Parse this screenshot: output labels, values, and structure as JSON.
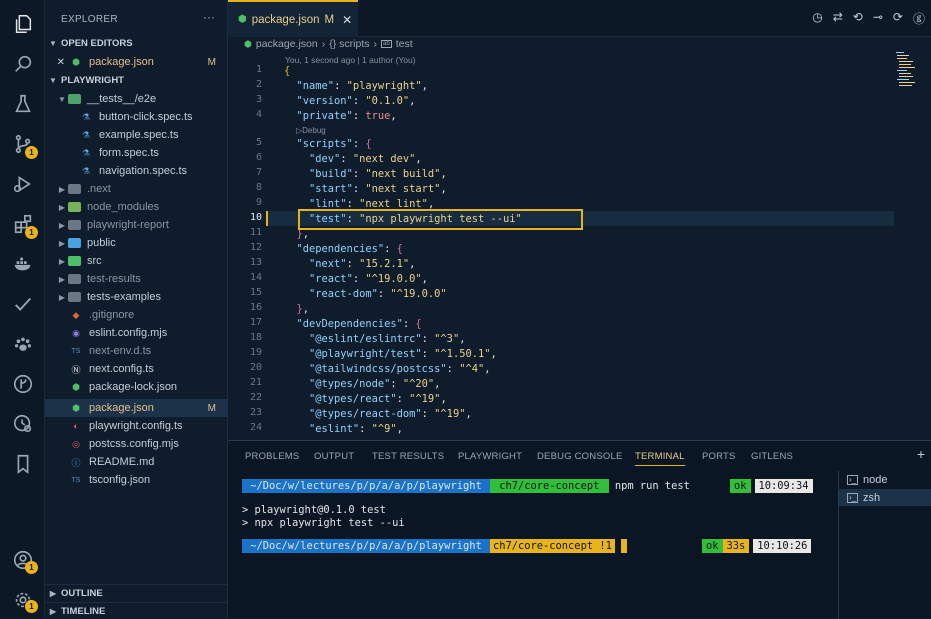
{
  "activity_bar": {
    "items": [
      {
        "icon": "files-icon"
      },
      {
        "icon": "search-icon"
      },
      {
        "icon": "beaker-icon"
      },
      {
        "icon": "source-control-icon",
        "badge": "1"
      },
      {
        "icon": "run-debug-icon"
      },
      {
        "icon": "extensions-icon",
        "badge": "1"
      },
      {
        "icon": "docker-icon"
      },
      {
        "icon": "checkmark-icon"
      },
      {
        "icon": "paw-icon"
      },
      {
        "icon": "git-graph-icon"
      },
      {
        "icon": "timeline-search-icon"
      },
      {
        "icon": "bookmark-icon"
      }
    ],
    "account_badge": "1",
    "settings_badge": "1"
  },
  "sidebar": {
    "title": "EXPLORER",
    "more": "···",
    "open_editors_label": "OPEN EDITORS",
    "open_editor": {
      "name": "package.json",
      "status": "M"
    },
    "workspace_label": "PLAYWRIGHT",
    "tree": [
      {
        "name": "__tests__/e2e",
        "kind": "folder-open"
      },
      {
        "name": "button-click.spec.ts",
        "kind": "test"
      },
      {
        "name": "example.spec.ts",
        "kind": "test"
      },
      {
        "name": "form.spec.ts",
        "kind": "test"
      },
      {
        "name": "navigation.spec.ts",
        "kind": "test"
      },
      {
        "name": ".next",
        "kind": "folder"
      },
      {
        "name": "node_modules",
        "kind": "folder"
      },
      {
        "name": "playwright-report",
        "kind": "folder"
      },
      {
        "name": "public",
        "kind": "folder"
      },
      {
        "name": "src",
        "kind": "folder"
      },
      {
        "name": "test-results",
        "kind": "folder"
      },
      {
        "name": "tests-examples",
        "kind": "folder"
      },
      {
        "name": ".gitignore",
        "kind": "file"
      },
      {
        "name": "eslint.config.mjs",
        "kind": "file"
      },
      {
        "name": "next-env.d.ts",
        "kind": "file"
      },
      {
        "name": "next.config.ts",
        "kind": "file"
      },
      {
        "name": "package-lock.json",
        "kind": "file"
      },
      {
        "name": "package.json",
        "kind": "file",
        "status": "M"
      },
      {
        "name": "playwright.config.ts",
        "kind": "file"
      },
      {
        "name": "postcss.config.mjs",
        "kind": "file"
      },
      {
        "name": "README.md",
        "kind": "file"
      },
      {
        "name": "tsconfig.json",
        "kind": "file"
      }
    ],
    "outline_label": "OUTLINE",
    "timeline_label": "TIMELINE"
  },
  "editor": {
    "tab": {
      "name": "package.json",
      "status": "M",
      "close": "✕"
    },
    "breadcrumb": [
      "package.json",
      "{} scripts",
      "test"
    ],
    "blame": "You, 1 second ago | 1 author (You)",
    "codelens": "▷Debug",
    "current_line": "10",
    "lines": [
      {
        "n": "1",
        "text": "{"
      },
      {
        "n": "2",
        "text": "  \"name\": \"playwright\","
      },
      {
        "n": "3",
        "text": "  \"version\": \"0.1.0\","
      },
      {
        "n": "4",
        "text": "  \"private\": true,"
      },
      {
        "n": "5",
        "text": "  \"scripts\": {"
      },
      {
        "n": "6",
        "text": "    \"dev\": \"next dev\","
      },
      {
        "n": "7",
        "text": "    \"build\": \"next build\","
      },
      {
        "n": "8",
        "text": "    \"start\": \"next start\","
      },
      {
        "n": "9",
        "text": "    \"lint\": \"next lint\","
      },
      {
        "n": "10",
        "text": "    \"test\": \"npx playwright test --ui\""
      },
      {
        "n": "11",
        "text": "  },"
      },
      {
        "n": "12",
        "text": "  \"dependencies\": {"
      },
      {
        "n": "13",
        "text": "    \"next\": \"15.2.1\","
      },
      {
        "n": "14",
        "text": "    \"react\": \"^19.0.0\","
      },
      {
        "n": "15",
        "text": "    \"react-dom\": \"^19.0.0\""
      },
      {
        "n": "16",
        "text": "  },"
      },
      {
        "n": "17",
        "text": "  \"devDependencies\": {"
      },
      {
        "n": "18",
        "text": "    \"@eslint/eslintrc\": \"^3\","
      },
      {
        "n": "19",
        "text": "    \"@playwright/test\": \"^1.50.1\","
      },
      {
        "n": "20",
        "text": "    \"@tailwindcss/postcss\": \"^4\","
      },
      {
        "n": "21",
        "text": "    \"@types/node\": \"^20\","
      },
      {
        "n": "22",
        "text": "    \"@types/react\": \"^19\","
      },
      {
        "n": "23",
        "text": "    \"@types/react-dom\": \"^19\","
      },
      {
        "n": "24",
        "text": "    \"eslint\": \"^9\","
      }
    ]
  },
  "panel": {
    "tabs": [
      "PROBLEMS",
      "OUTPUT",
      "TEST RESULTS",
      "PLAYWRIGHT",
      "DEBUG CONSOLE",
      "TERMINAL",
      "PORTS",
      "GITLENS"
    ],
    "active_tab": "TERMINAL",
    "add": "+",
    "terminal": {
      "prompt1": {
        "path": " ~/Doc/w/lectures/p/p/a/a/p/playwright ",
        "branch": " ch7/core-concept ",
        "command": " npm run test",
        "status": "ok",
        "time": "10:09:34"
      },
      "output": [
        "> playwright@0.1.0 test",
        "> npx playwright test --ui"
      ],
      "prompt2": {
        "path": " ~/Doc/w/lectures/p/p/a/a/p/playwright ",
        "branch": "ch7/core-concept !1",
        "status": "ok",
        "duration": "33s",
        "time": "10:10:26"
      }
    },
    "terminals": [
      {
        "name": "node"
      },
      {
        "name": "zsh"
      }
    ]
  }
}
